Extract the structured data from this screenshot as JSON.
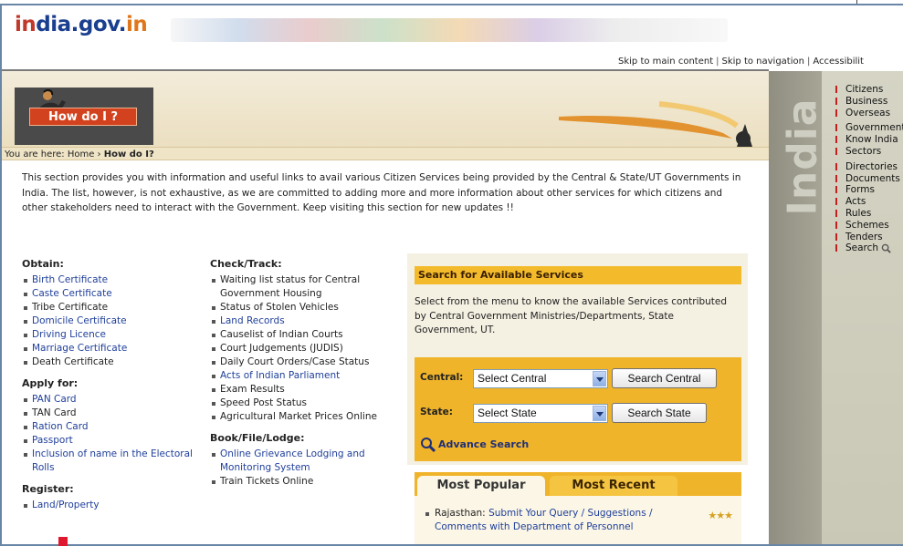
{
  "header": {
    "logo_part1": "in",
    "logo_part2": "dia.gov.",
    "logo_part3": "in",
    "skip_main": "Skip to main content",
    "skip_nav": "Skip to navigation",
    "accessibility": "Accessibilit"
  },
  "hero": {
    "title": "How do I ?"
  },
  "breadcrumb": {
    "prefix": "You are here: Home › ",
    "current": "How do I?"
  },
  "intro": "This section provides you with information and useful links to avail various Citizen Services being provided by the Central & State/UT Governments in India. The list, however, is not exhaustive, as we are committed to adding more and more information about other services for which citizens and other stakeholders need to interact with the Government. Keep visiting this section for new updates !!",
  "obtain": {
    "heading": "Obtain:",
    "items": [
      {
        "label": "Birth Certificate",
        "link": true
      },
      {
        "label": "Caste Certificate",
        "link": true
      },
      {
        "label": "Tribe Certificate",
        "link": false
      },
      {
        "label": "Domicile Certificate",
        "link": true
      },
      {
        "label": "Driving Licence",
        "link": true
      },
      {
        "label": "Marriage Certificate",
        "link": true
      },
      {
        "label": "Death Certificate",
        "link": false
      }
    ]
  },
  "apply": {
    "heading": "Apply for:",
    "items": [
      {
        "label": "PAN Card",
        "link": true
      },
      {
        "label": "TAN Card",
        "link": false
      },
      {
        "label": "Ration Card",
        "link": true
      },
      {
        "label": "Passport",
        "link": true
      },
      {
        "label": "Inclusion of name in the Electoral Rolls",
        "link": true
      }
    ]
  },
  "register": {
    "heading": "Register:",
    "items": [
      {
        "label": "Land/Property",
        "link": true
      }
    ]
  },
  "check": {
    "heading": "Check/Track:",
    "items": [
      {
        "label": "Waiting list status for Central Government Housing",
        "link": false
      },
      {
        "label": "Status of Stolen Vehicles",
        "link": false
      },
      {
        "label": "Land Records",
        "link": true
      },
      {
        "label": "Causelist of Indian Courts",
        "link": false
      },
      {
        "label": "Court Judgements (JUDIS)",
        "link": false
      },
      {
        "label": "Daily Court Orders/Case Status",
        "link": false
      },
      {
        "label": "Acts of Indian Parliament",
        "link": true
      },
      {
        "label": "Exam Results",
        "link": false
      },
      {
        "label": "Speed Post Status",
        "link": false
      },
      {
        "label": "Agricultural Market Prices Online",
        "link": false
      }
    ]
  },
  "book": {
    "heading": "Book/File/Lodge:",
    "items": [
      {
        "label": "Online Grievance Lodging and Monitoring System",
        "link": true
      },
      {
        "label": "Train Tickets Online",
        "link": false
      }
    ]
  },
  "search": {
    "heading": "Search for Available Services",
    "description": "Select from the menu to know the available Services contributed by Central Government Ministries/Departments, State Government, UT.",
    "central_label": "Central:",
    "central_select": "Select Central",
    "central_button": "Search Central",
    "state_label": "State:",
    "state_select": "Select State",
    "state_button": "Search State",
    "advance": "Advance Search"
  },
  "tabs": {
    "popular": "Most Popular",
    "recent": "Most Recent"
  },
  "popular_item": {
    "prefix": "Rajasthan: ",
    "link": "Submit Your Query / Suggestions / Comments with Department of Personnel",
    "stars": "★★★"
  },
  "sidebar": {
    "vertical_word": "India",
    "items": [
      "Citizens",
      "Business",
      "Overseas",
      "Government",
      "Know India",
      "Sectors",
      "Directories",
      "Documents",
      "Forms",
      "Acts",
      "Rules",
      "Schemes",
      "Tenders",
      "Search"
    ]
  },
  "colors": {
    "accent_orange": "#f0b42a",
    "link_blue": "#1f3f9a",
    "hero_red": "#d2421f"
  }
}
